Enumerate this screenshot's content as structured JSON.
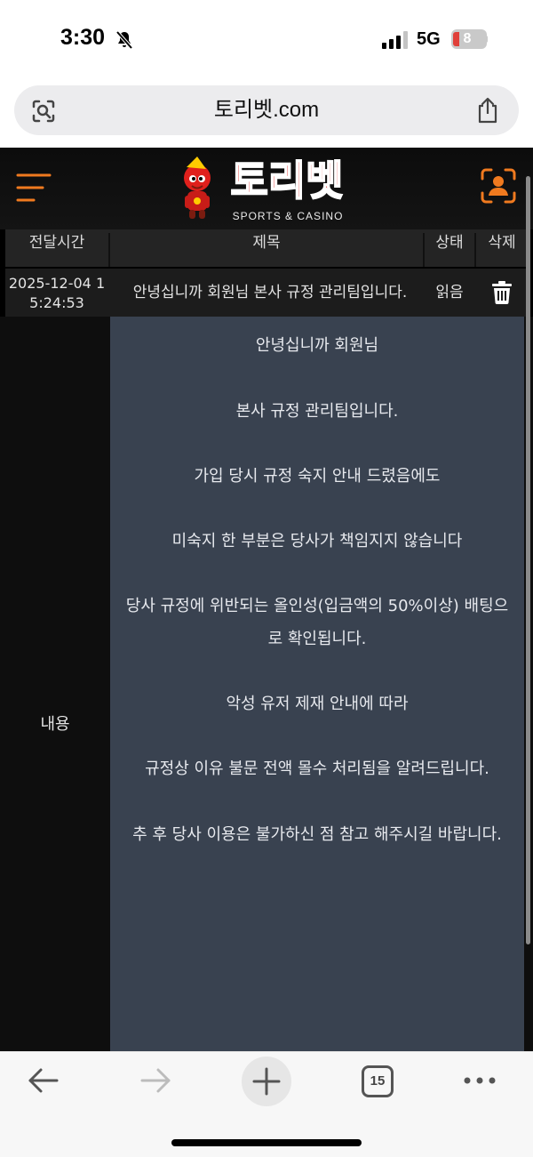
{
  "status_bar": {
    "time": "3:30",
    "network": "5G",
    "battery": "8"
  },
  "browser": {
    "url": "토리벳.com",
    "tab_count": "15"
  },
  "site": {
    "logo_text": "토리벳",
    "logo_sub": "SPORTS & CASINO"
  },
  "table": {
    "headers": {
      "date": "전달시간",
      "title": "제목",
      "status": "상태",
      "delete": "삭제"
    },
    "row": {
      "date_line1": "2025-12-04 1",
      "date_line2": "5:24:53",
      "title": "안녕십니까 회원님 본사 규정 관리팀입니다.",
      "status": "읽음"
    },
    "content_label": "내용",
    "content_lines": [
      "안녕십니까 회원님",
      "본사 규정 관리팀입니다.",
      "가입 당시 규정 숙지 안내 드렸음에도",
      "미숙지 한 부분은 당사가 책임지지 않습니다",
      "당사 규정에 위반되는 올인성(입금액의 50%이상) 배팅으",
      "로 확인됩니다.",
      "악성 유저 제재 안내에 따라",
      "규정상 이유 불문 전액 몰수 처리됨을 알려드립니다.",
      "추 후 당사 이용은 불가하신 점 참고 해주시길 바랍니다."
    ]
  },
  "colors": {
    "accent_orange": "#f07a1f",
    "logo_red": "#e0201c",
    "content_bg": "#394250"
  }
}
